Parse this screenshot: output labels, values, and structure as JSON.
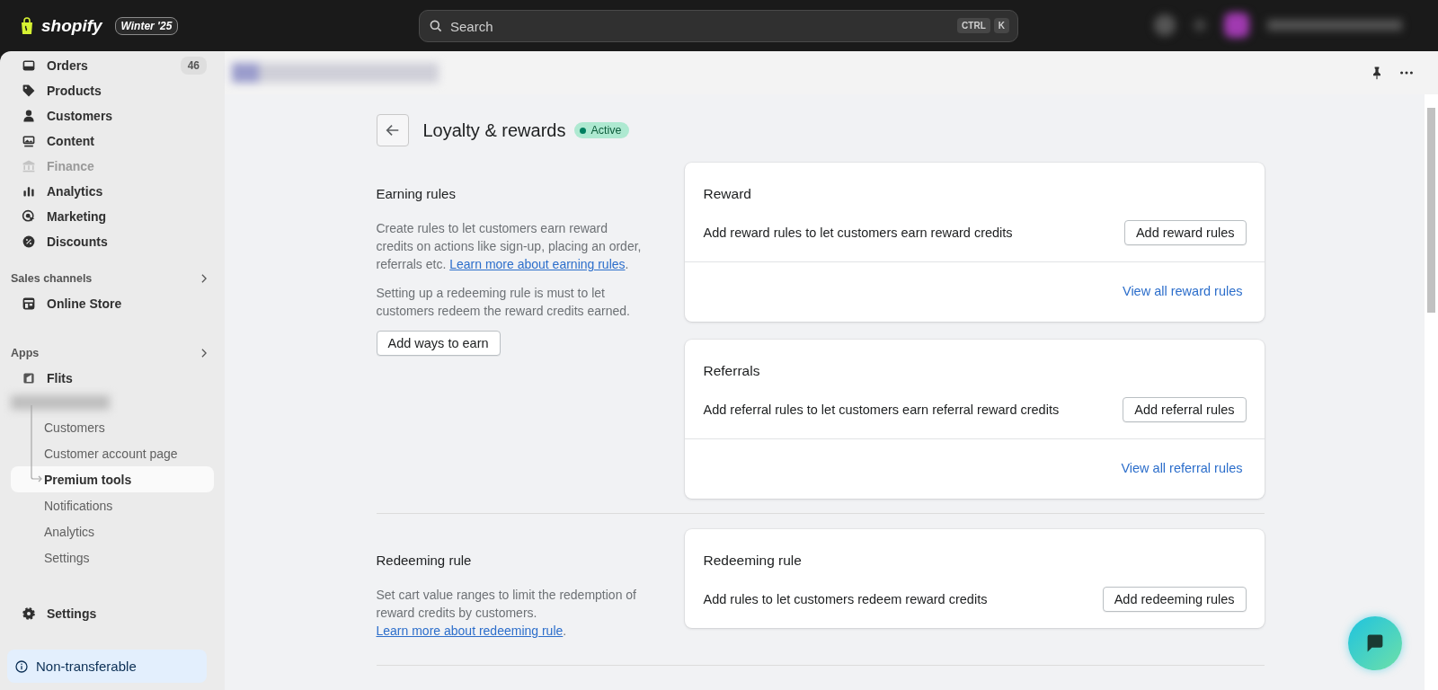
{
  "topbar": {
    "logo": "shopify",
    "version": "Winter '25",
    "search": {
      "placeholder": "Search"
    },
    "shortcut": [
      "CTRL",
      "K"
    ]
  },
  "sidebar": {
    "items": [
      {
        "label": "Orders",
        "count": "46",
        "disabled": false
      },
      {
        "label": "Products",
        "disabled": false
      },
      {
        "label": "Customers",
        "disabled": false
      },
      {
        "label": "Content",
        "disabled": false
      },
      {
        "label": "Finance",
        "disabled": true
      },
      {
        "label": "Analytics",
        "disabled": false
      },
      {
        "label": "Marketing",
        "disabled": false
      },
      {
        "label": "Discounts",
        "disabled": false
      }
    ],
    "sales_channels": {
      "heading": "Sales channels",
      "items": [
        {
          "label": "Online Store"
        }
      ]
    },
    "apps": {
      "heading": "Apps",
      "items": [
        {
          "label": "Flits"
        }
      ],
      "subitems": [
        {
          "label": "Customers",
          "selected": false
        },
        {
          "label": "Customer account page",
          "selected": false
        },
        {
          "label": "Premium tools",
          "selected": true
        },
        {
          "label": "Notifications",
          "selected": false
        },
        {
          "label": "Analytics",
          "selected": false
        },
        {
          "label": "Settings",
          "selected": false
        }
      ]
    },
    "settings": "Settings",
    "notice": "Non-transferable"
  },
  "page": {
    "title": "Loyalty & rewards",
    "status": "Active",
    "sections": [
      {
        "heading": "Earning rules",
        "paragraphs": [
          {
            "text": "Create rules to let customers earn reward credits on actions like sign-up, placing an order, referrals etc.",
            "link": "Learn more about earning rules",
            "after": "."
          },
          {
            "text": "Setting up a redeeming rule is must to let customers redeem the reward credits earned."
          }
        ],
        "button": "Add ways to earn",
        "cards": [
          {
            "title": "Reward",
            "description": "Add reward rules to let customers earn reward credits",
            "button": "Add reward rules",
            "link": "View all reward rules"
          },
          {
            "title": "Referrals",
            "description": "Add referral rules to let customers earn referral reward credits",
            "button": "Add referral rules",
            "link": "View all referral rules"
          }
        ]
      },
      {
        "heading": "Redeeming rule",
        "paragraphs": [
          {
            "text": "Set cart value ranges to limit the redemption of reward credits by customers.",
            "link": "Learn more about redeeming rule",
            "after": "."
          }
        ],
        "cards": [
          {
            "title": "Redeeming rule",
            "description": "Add rules to let customers redeem reward credits",
            "button": "Add redeeming rules"
          }
        ]
      }
    ]
  }
}
